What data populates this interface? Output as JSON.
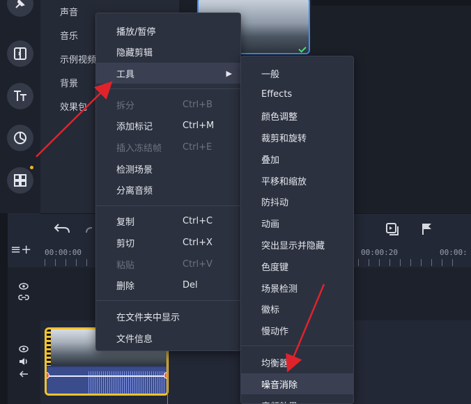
{
  "categories": [
    "声音",
    "音乐",
    "示例视频",
    "背景",
    "效果包"
  ],
  "timeline": {
    "ruler_labels": [
      "00:00:00",
      "00:00:20",
      "00:00:"
    ]
  },
  "context_menu": {
    "groups": [
      [
        {
          "label": "播放/暂停",
          "shortcut": "",
          "disabled": false
        },
        {
          "label": "隐藏剪辑",
          "shortcut": "",
          "disabled": false
        },
        {
          "label": "工具",
          "shortcut": "",
          "disabled": false,
          "submenu": true,
          "active": true
        }
      ],
      [
        {
          "label": "拆分",
          "shortcut": "Ctrl+B",
          "disabled": true
        },
        {
          "label": "添加标记",
          "shortcut": "Ctrl+M",
          "disabled": false
        },
        {
          "label": "插入冻结帧",
          "shortcut": "Ctrl+E",
          "disabled": true
        },
        {
          "label": "检测场景",
          "shortcut": "",
          "disabled": false
        },
        {
          "label": "分离音频",
          "shortcut": "",
          "disabled": false
        }
      ],
      [
        {
          "label": "复制",
          "shortcut": "Ctrl+C",
          "disabled": false
        },
        {
          "label": "剪切",
          "shortcut": "Ctrl+X",
          "disabled": false
        },
        {
          "label": "粘贴",
          "shortcut": "Ctrl+V",
          "disabled": true
        },
        {
          "label": "删除",
          "shortcut": "Del",
          "disabled": false
        }
      ],
      [
        {
          "label": "在文件夹中显示",
          "shortcut": "",
          "disabled": false
        },
        {
          "label": "文件信息",
          "shortcut": "",
          "disabled": false
        }
      ]
    ]
  },
  "tools_submenu": {
    "groups": [
      [
        "一般",
        "Effects",
        "颜色调整",
        "裁剪和旋转",
        "叠加",
        "平移和缩放",
        "防抖动",
        "动画",
        "突出显示并隐藏",
        "色度键",
        "场景检测",
        "徽标",
        "慢动作"
      ],
      [
        "均衡器",
        "噪音消除",
        "音频效果"
      ]
    ],
    "hovered": "噪音消除"
  },
  "colors": {
    "accent_blue": "#3d8df5",
    "clip_yellow": "#f2c230",
    "arrow_red": "#e0232b",
    "notification_dot": "#f0b429"
  }
}
